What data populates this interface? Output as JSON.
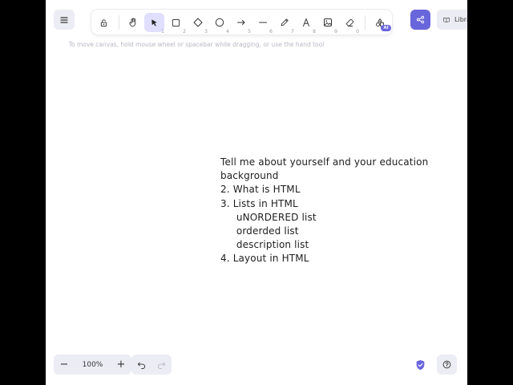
{
  "toolbar": {
    "tools": [
      {
        "name": "lock-icon",
        "num": ""
      },
      {
        "name": "hand-icon",
        "num": ""
      },
      {
        "name": "selection-icon",
        "num": "1"
      },
      {
        "name": "rectangle-icon",
        "num": "2"
      },
      {
        "name": "diamond-icon",
        "num": "3"
      },
      {
        "name": "ellipse-icon",
        "num": "4"
      },
      {
        "name": "arrow-icon",
        "num": "5"
      },
      {
        "name": "line-icon",
        "num": "6"
      },
      {
        "name": "pencil-icon",
        "num": "7"
      },
      {
        "name": "text-icon",
        "num": "8"
      },
      {
        "name": "image-icon",
        "num": "9"
      },
      {
        "name": "eraser-icon",
        "num": "0"
      },
      {
        "name": "extra-tools-icon",
        "num": ""
      }
    ],
    "ai_badge": "AI"
  },
  "library_label": "Library",
  "hint_text": "To move canvas, hold mouse wheel or spacebar while dragging, or use the hand tool",
  "drawing": {
    "lines": [
      "Tell me about yourself and your education",
      "background",
      "2. What is HTML",
      "3. Lists in HTML",
      "     uNORDERED list",
      "     orderded list",
      "     description list",
      "4. Layout in HTML"
    ]
  },
  "zoom": {
    "level": "100%",
    "minus": "−",
    "plus": "+"
  },
  "colors": {
    "accent": "#6965db",
    "active_tool_bg": "#e0dfff",
    "panel_bg": "#ececf4"
  }
}
